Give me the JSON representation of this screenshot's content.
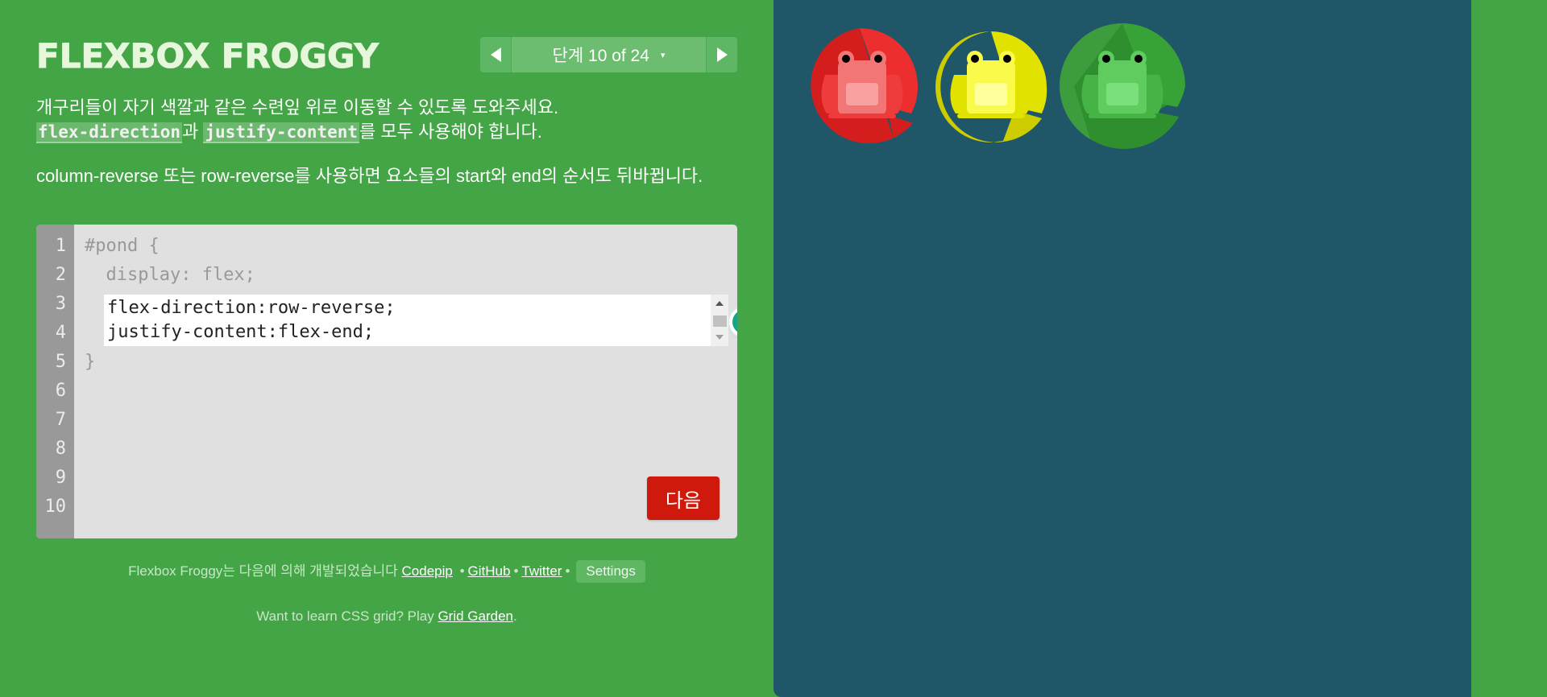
{
  "app": {
    "title": "FLEXBOX FROGGY"
  },
  "level_nav": {
    "indicator": "단계 10 of 24",
    "caret": "▾"
  },
  "instructions": {
    "line1": "개구리들이 자기 색깔과 같은 수련잎 위로 이동할 수 있도록 도와주세요.",
    "line2_code1": "flex-direction",
    "line2_mid": "과",
    "line2_code2": "justify-content",
    "line2_tail": "를 모두 사용해야 합니다.",
    "line3": "column-reverse 또는 row-reverse를 사용하면 요소들의 start와 end의 순서도 뒤바뀝니다."
  },
  "editor": {
    "line_numbers": [
      "1",
      "2",
      "3",
      "4",
      "5",
      "6",
      "7",
      "8",
      "9",
      "10"
    ],
    "line1": "#pond {",
    "line2": "  display: flex;",
    "input_line1": "flex-direction:row-reverse;",
    "input_line2": "justify-content:flex-end;",
    "line5": "}",
    "next_label": "다음"
  },
  "footer": {
    "credits_prefix": "Flexbox Froggy는 다음에 의해 개발되었습니다",
    "codepip": "Codepip",
    "github": "GitHub",
    "twitter": "Twitter",
    "separator": "•",
    "settings": "Settings",
    "grid_prefix": "Want to learn CSS grid? Play",
    "grid_link": "Grid Garden",
    "grid_suffix": "."
  },
  "pond": {
    "frogs": [
      {
        "color": "red",
        "pad": "#d41e1e",
        "body": "#f37676",
        "shade": "#ee3b3b"
      },
      {
        "color": "yellow",
        "pad": "#cccc00",
        "body": "#fafa4a",
        "shade": "#e2e200"
      },
      {
        "color": "green",
        "pad": "#2f8f2f",
        "body": "#7be07b",
        "shade": "#45b345"
      }
    ]
  },
  "colors": {
    "sidebar_bg": "#44a547",
    "pond_bg": "#1f5768",
    "next_button": "#d0190d"
  }
}
